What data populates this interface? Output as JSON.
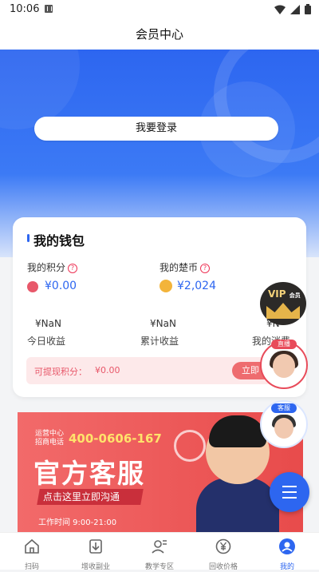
{
  "status_bar": {
    "time": "10:06"
  },
  "header": {
    "title": "会员中心"
  },
  "login": {
    "label": "我要登录"
  },
  "wallet": {
    "title": "我的钱包",
    "points_label": "我的积分",
    "points_value": "¥0.00",
    "coins_label": "我的楚币",
    "coins_value": "¥2,024",
    "stats": [
      {
        "value": "¥NaN",
        "label": "今日收益"
      },
      {
        "value": "¥NaN",
        "label": "累计收益"
      },
      {
        "value": "¥N",
        "label": "我的消费"
      }
    ],
    "withdraw_label": "可提现积分：",
    "withdraw_value": "¥0.00",
    "withdraw_button": "立即"
  },
  "banner": {
    "small_line1": "运营中心",
    "small_line2": "招商电话",
    "phone": "400-0606-167",
    "headline": "官方客服",
    "cta": "点击这里立即沟通",
    "hours": "工作时间 9:00-21:00"
  },
  "floats": {
    "vip_label": "VIP",
    "vip_sub": "会员",
    "live_tag": "直播",
    "cs_tag": "客服"
  },
  "tabs": [
    {
      "label": "扫码",
      "icon": "home-icon"
    },
    {
      "label": "增收副业",
      "icon": "download-icon"
    },
    {
      "label": "教学专区",
      "icon": "user-edit-icon"
    },
    {
      "label": "回收价格",
      "icon": "yen-icon"
    },
    {
      "label": "我的",
      "icon": "profile-icon"
    }
  ],
  "colors": {
    "primary": "#2d66f0",
    "accent": "#e84b5a"
  }
}
